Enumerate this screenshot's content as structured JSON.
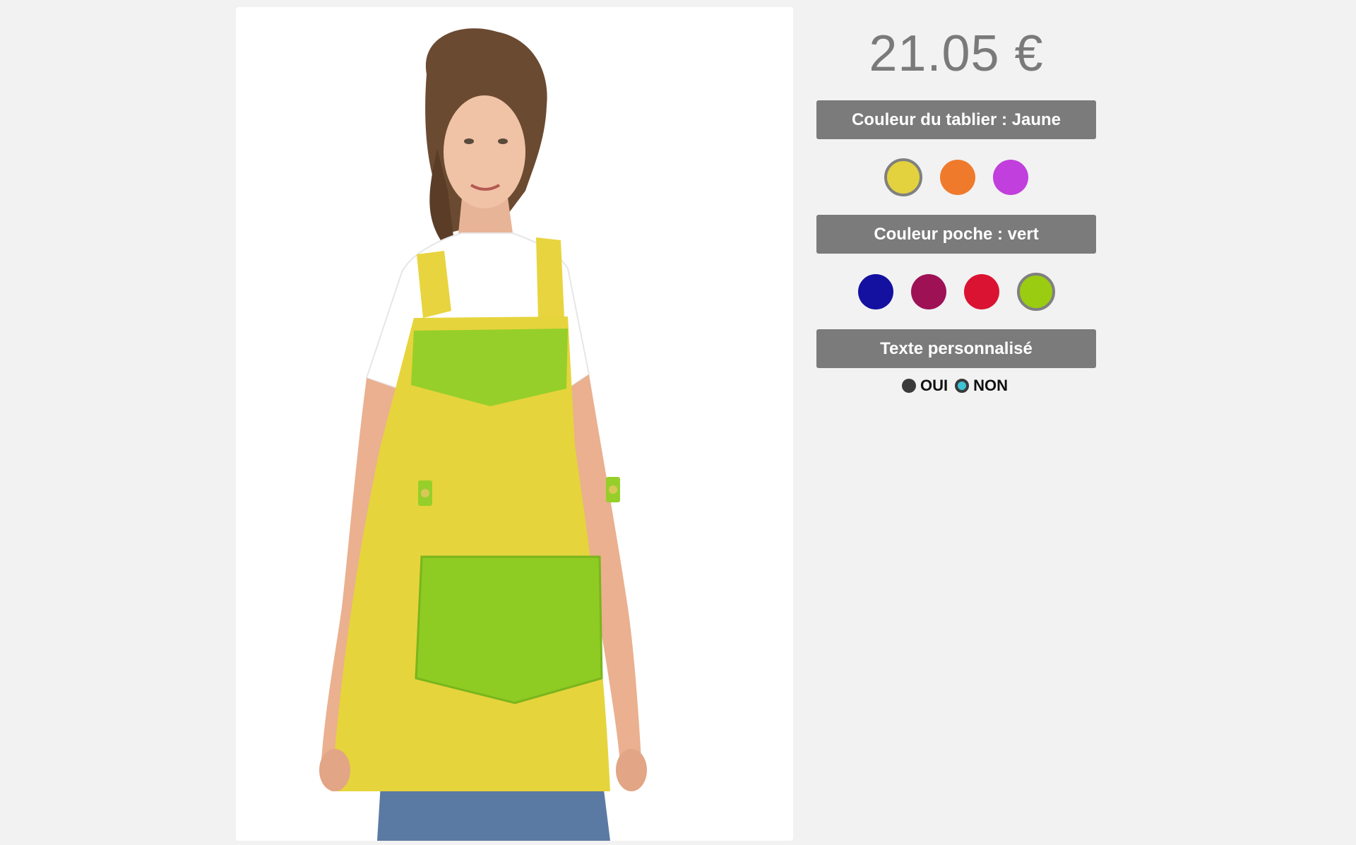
{
  "product": {
    "image_alt": "Woman wearing a yellow apron with green yoke and pocket"
  },
  "price": {
    "value": "21.05 €"
  },
  "apron_color": {
    "header": "Couleur du tablier : Jaune",
    "swatches": [
      {
        "name": "jaune",
        "color": "#e3d23e",
        "selected": true
      },
      {
        "name": "orange",
        "color": "#f07a2c",
        "selected": false
      },
      {
        "name": "violet",
        "color": "#c03fdd",
        "selected": false
      }
    ]
  },
  "pocket_color": {
    "header": "Couleur poche : vert",
    "swatches": [
      {
        "name": "bleu",
        "color": "#1410a0",
        "selected": false
      },
      {
        "name": "bordeaux",
        "color": "#9e1155",
        "selected": false
      },
      {
        "name": "rouge",
        "color": "#da1332",
        "selected": false
      },
      {
        "name": "vert",
        "color": "#9acd11",
        "selected": true
      }
    ]
  },
  "custom_text": {
    "header": "Texte personnalisé",
    "options": [
      {
        "label": "OUI",
        "checked": false
      },
      {
        "label": "NON",
        "checked": true
      }
    ]
  }
}
